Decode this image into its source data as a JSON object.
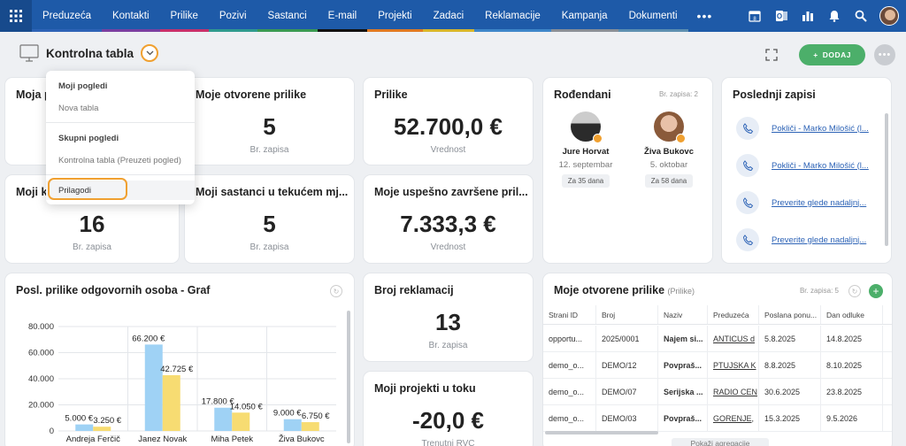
{
  "nav": {
    "items": [
      {
        "label": "Preduzeća",
        "color": "#2d63b6"
      },
      {
        "label": "Kontakti",
        "color": "#7a3fa0"
      },
      {
        "label": "Prilike",
        "color": "#c8306a"
      },
      {
        "label": "Pozivi",
        "color": "#2f9a8e"
      },
      {
        "label": "Sastanci",
        "color": "#3a9a52"
      },
      {
        "label": "E-mail",
        "color": "#111111"
      },
      {
        "label": "Projekti",
        "color": "#e07a22"
      },
      {
        "label": "Zadaci",
        "color": "#d8b62a"
      },
      {
        "label": "Reklamacije",
        "color": "#3e86c9"
      },
      {
        "label": "Kampanja",
        "color": "#8a8f96"
      },
      {
        "label": "Dokumenti",
        "color": "#5d8fb0"
      }
    ],
    "more": "•••"
  },
  "header": {
    "title": "Kontrolna tabla",
    "add_label": "DODAJ"
  },
  "dropdown": {
    "section1": "Moji pogledi",
    "item1": "Nova tabla",
    "section2": "Skupni pogledi",
    "item2": "Kontrolna tabla (Preuzeti pogled)",
    "customize": "Prilagodi"
  },
  "cards": {
    "c1_title": "Moja p",
    "c2_title": "Moje otvorene prilike",
    "c2_value": "5",
    "c2_sub": "Br. zapisa",
    "c3_title": "Prilike",
    "c3_value": "52.700,0 €",
    "c3_sub": "Vrednost",
    "c4_title": "Moji k",
    "c4_value": "16",
    "c4_sub": "Br. zapisa",
    "c5_title": "Moji sastanci u tekućem mj...",
    "c5_value": "5",
    "c5_sub": "Br. zapisa",
    "c6_title": "Moje uspešno završene pril...",
    "c6_value": "7.333,3 €",
    "c6_sub": "Vrednost",
    "c7_title": "Broj reklamacij",
    "c7_value": "13",
    "c7_sub": "Br. zapisa",
    "c8_title": "Moji projekti u toku",
    "c8_value": "-20,0 €",
    "c8_sub": "Trenutni RVC"
  },
  "birthdays": {
    "title": "Rođendani",
    "count": "Br. zapisa: 2",
    "people": [
      {
        "name": "Jure Horvat",
        "date": "12. septembar",
        "days": "Za 35 dana"
      },
      {
        "name": "Živa Bukovc",
        "date": "5. oktobar",
        "days": "Za 58 dana"
      }
    ]
  },
  "last_records": {
    "title": "Poslednji zapisi",
    "items": [
      "Pokliči - Marko Milošić (l...",
      "Pokliči - Marko Milošić (l...",
      "Preverite glede nadaljnj...",
      "Preverite glede nadaljnj..."
    ]
  },
  "graph": {
    "title": "Posl. prilike odgovornih osoba - Graf"
  },
  "chart_data": {
    "type": "bar",
    "title": "Posl. prilike odgovornih osoba - Graf",
    "categories": [
      "Andreja Ferčič",
      "Janez Novak",
      "Miha Petek",
      "Živa Bukovc"
    ],
    "series": [
      {
        "values": [
          5000,
          66200,
          17800,
          9000
        ],
        "labels": [
          "5.000 €",
          "66.200 €",
          "17.800 €",
          "9.000 €"
        ],
        "color": "#9fd2f5"
      },
      {
        "values": [
          3250,
          42725,
          14050,
          6750
        ],
        "labels": [
          "3.250 €",
          "42.725 €",
          "14.050 €",
          "6.750 €"
        ],
        "color": "#f7dc72"
      }
    ],
    "ylim": [
      0,
      80000
    ],
    "yticks": [
      "0",
      "20.000",
      "40.000",
      "60.000",
      "80.000"
    ],
    "grid": true
  },
  "table": {
    "title": "Moje otvorene prilike",
    "subtitle": "(Prilike)",
    "count": "Br. zapisa: 5",
    "columns": [
      "Strani ID",
      "Broj",
      "Naziv",
      "Preduzeća",
      "Poslana ponu...",
      "Dan odluke"
    ],
    "rows": [
      [
        "opportu...",
        "2025/0001",
        "Najem si...",
        "ANTICUS d",
        "5.8.2025",
        "14.8.2025"
      ],
      [
        "demo_o...",
        "DEMO/12",
        "Povpraš...",
        "PTUJSKA K",
        "8.8.2025",
        "8.10.2025"
      ],
      [
        "demo_o...",
        "DEMO/07",
        "Serijska ...",
        "RADIO CEN",
        "30.6.2025",
        "23.8.2025"
      ],
      [
        "demo_o...",
        "DEMO/03",
        "Povpraš...",
        "GORENJE,",
        "15.3.2025",
        "9.5.2026"
      ]
    ],
    "footer": "Pokaži agregacije"
  }
}
